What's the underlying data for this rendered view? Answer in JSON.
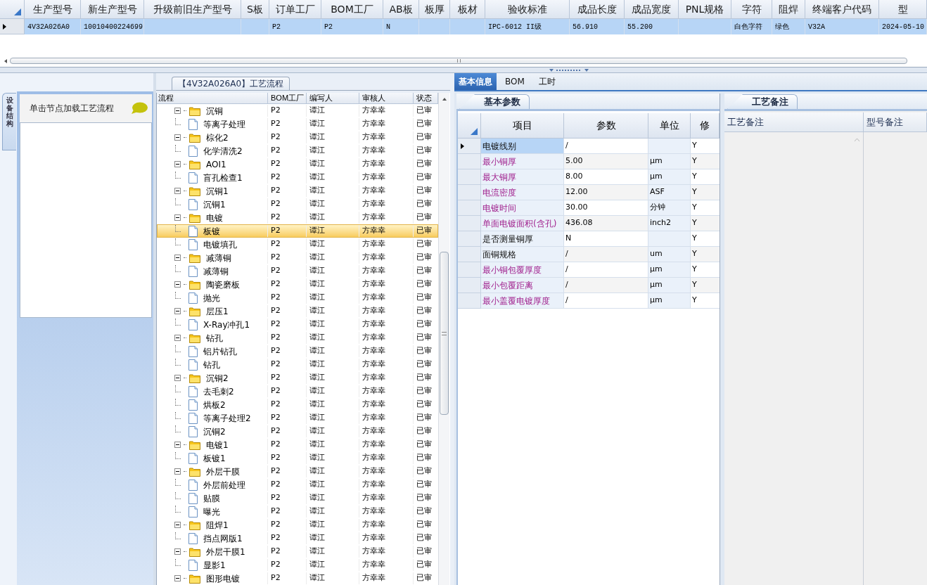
{
  "product_grid": {
    "columns": [
      "生产型号",
      "新生产型号",
      "升级前旧生产型号",
      "S板",
      "订单工厂",
      "BOM工厂",
      "AB板",
      "板厚",
      "板材",
      "验收标准",
      "成品长度",
      "成品宽度",
      "PNL规格",
      "字符",
      "阻焊",
      "终端客户代码",
      "型"
    ],
    "rows": [
      {
        "selected": true,
        "cells": [
          "4V32A026A0",
          "10010400224699",
          "",
          "",
          "P2",
          "P2",
          "N",
          "",
          "",
          "IPC-6012 II级",
          "56.910",
          "55.200",
          "",
          "白色字符",
          "绿色",
          "V32A",
          "2024-05-10"
        ]
      }
    ]
  },
  "side_tab": "设备结构",
  "hint": "单击节点加载工艺流程",
  "flow_title": "【4V32A026A0】工艺流程",
  "tree": {
    "columns": [
      "流程",
      "BOM工厂",
      "编写人",
      "审核人",
      "状态"
    ],
    "nodes": [
      {
        "label": "沉铜",
        "bom": "P2",
        "author": "谭江",
        "reviewer": "方幸幸",
        "status": "已审",
        "expanded": true,
        "selected": false,
        "children": [
          {
            "label": "等离子处理",
            "bom": "P2",
            "author": "谭江",
            "reviewer": "方幸幸",
            "status": "已审",
            "selected": false
          }
        ]
      },
      {
        "label": "棕化2",
        "bom": "P2",
        "author": "谭江",
        "reviewer": "方幸幸",
        "status": "已审",
        "expanded": true,
        "selected": false,
        "children": [
          {
            "label": "化学清洗2",
            "bom": "P2",
            "author": "谭江",
            "reviewer": "方幸幸",
            "status": "已审",
            "selected": false
          }
        ]
      },
      {
        "label": "AOI1",
        "bom": "P2",
        "author": "谭江",
        "reviewer": "方幸幸",
        "status": "已审",
        "expanded": true,
        "selected": false,
        "children": [
          {
            "label": "盲孔检查1",
            "bom": "P2",
            "author": "谭江",
            "reviewer": "方幸幸",
            "status": "已审",
            "selected": false
          }
        ]
      },
      {
        "label": "沉铜1",
        "bom": "P2",
        "author": "谭江",
        "reviewer": "方幸幸",
        "status": "已审",
        "expanded": true,
        "selected": false,
        "children": [
          {
            "label": "沉铜1",
            "bom": "P2",
            "author": "谭江",
            "reviewer": "方幸幸",
            "status": "已审",
            "selected": false
          }
        ]
      },
      {
        "label": "电镀",
        "bom": "P2",
        "author": "谭江",
        "reviewer": "方幸幸",
        "status": "已审",
        "expanded": true,
        "selected": false,
        "children": [
          {
            "label": "板镀",
            "bom": "P2",
            "author": "谭江",
            "reviewer": "方幸幸",
            "status": "已审",
            "selected": true
          },
          {
            "label": "电镀填孔",
            "bom": "P2",
            "author": "谭江",
            "reviewer": "方幸幸",
            "status": "已审",
            "selected": false
          }
        ]
      },
      {
        "label": "减薄铜",
        "bom": "P2",
        "author": "谭江",
        "reviewer": "方幸幸",
        "status": "已审",
        "expanded": true,
        "selected": false,
        "children": [
          {
            "label": "减薄铜",
            "bom": "P2",
            "author": "谭江",
            "reviewer": "方幸幸",
            "status": "已审",
            "selected": false
          }
        ]
      },
      {
        "label": "陶瓷磨板",
        "bom": "P2",
        "author": "谭江",
        "reviewer": "方幸幸",
        "status": "已审",
        "expanded": true,
        "selected": false,
        "children": [
          {
            "label": "抛光",
            "bom": "P2",
            "author": "谭江",
            "reviewer": "方幸幸",
            "status": "已审",
            "selected": false
          }
        ]
      },
      {
        "label": "层压1",
        "bom": "P2",
        "author": "谭江",
        "reviewer": "方幸幸",
        "status": "已审",
        "expanded": true,
        "selected": false,
        "children": [
          {
            "label": "X-Ray冲孔1",
            "bom": "P2",
            "author": "谭江",
            "reviewer": "方幸幸",
            "status": "已审",
            "selected": false
          }
        ]
      },
      {
        "label": "钻孔",
        "bom": "P2",
        "author": "谭江",
        "reviewer": "方幸幸",
        "status": "已审",
        "expanded": true,
        "selected": false,
        "children": [
          {
            "label": "铝片钻孔",
            "bom": "P2",
            "author": "谭江",
            "reviewer": "方幸幸",
            "status": "已审",
            "selected": false
          },
          {
            "label": "钻孔",
            "bom": "P2",
            "author": "谭江",
            "reviewer": "方幸幸",
            "status": "已审",
            "selected": false
          }
        ]
      },
      {
        "label": "沉铜2",
        "bom": "P2",
        "author": "谭江",
        "reviewer": "方幸幸",
        "status": "已审",
        "expanded": true,
        "selected": false,
        "children": [
          {
            "label": "去毛刺2",
            "bom": "P2",
            "author": "谭江",
            "reviewer": "方幸幸",
            "status": "已审",
            "selected": false
          },
          {
            "label": "烘板2",
            "bom": "P2",
            "author": "谭江",
            "reviewer": "方幸幸",
            "status": "已审",
            "selected": false
          },
          {
            "label": "等离子处理2",
            "bom": "P2",
            "author": "谭江",
            "reviewer": "方幸幸",
            "status": "已审",
            "selected": false
          },
          {
            "label": "沉铜2",
            "bom": "P2",
            "author": "谭江",
            "reviewer": "方幸幸",
            "status": "已审",
            "selected": false
          }
        ]
      },
      {
        "label": "电镀1",
        "bom": "P2",
        "author": "谭江",
        "reviewer": "方幸幸",
        "status": "已审",
        "expanded": true,
        "selected": false,
        "children": [
          {
            "label": "板镀1",
            "bom": "P2",
            "author": "谭江",
            "reviewer": "方幸幸",
            "status": "已审",
            "selected": false
          }
        ]
      },
      {
        "label": "外层干膜",
        "bom": "P2",
        "author": "谭江",
        "reviewer": "方幸幸",
        "status": "已审",
        "expanded": true,
        "selected": false,
        "children": [
          {
            "label": "外层前处理",
            "bom": "P2",
            "author": "谭江",
            "reviewer": "方幸幸",
            "status": "已审",
            "selected": false
          },
          {
            "label": "贴膜",
            "bom": "P2",
            "author": "谭江",
            "reviewer": "方幸幸",
            "status": "已审",
            "selected": false
          },
          {
            "label": "曝光",
            "bom": "P2",
            "author": "谭江",
            "reviewer": "方幸幸",
            "status": "已审",
            "selected": false
          }
        ]
      },
      {
        "label": "阻焊1",
        "bom": "P2",
        "author": "谭江",
        "reviewer": "方幸幸",
        "status": "已审",
        "expanded": true,
        "selected": false,
        "children": [
          {
            "label": "挡点网版1",
            "bom": "P2",
            "author": "谭江",
            "reviewer": "方幸幸",
            "status": "已审",
            "selected": false
          }
        ]
      },
      {
        "label": "外层干膜1",
        "bom": "P2",
        "author": "谭江",
        "reviewer": "方幸幸",
        "status": "已审",
        "expanded": true,
        "selected": false,
        "children": [
          {
            "label": "显影1",
            "bom": "P2",
            "author": "谭江",
            "reviewer": "方幸幸",
            "status": "已审",
            "selected": false
          }
        ]
      },
      {
        "label": "图形电镀",
        "bom": "P2",
        "author": "谭江",
        "reviewer": "方幸幸",
        "status": "已审",
        "expanded": true,
        "selected": false
      }
    ]
  },
  "detail_tabs": [
    {
      "label": "基本信息",
      "selected": true
    },
    {
      "label": "BOM",
      "selected": false
    },
    {
      "label": "工时",
      "selected": false
    }
  ],
  "params": {
    "tab": "基本参数",
    "columns": [
      "项目",
      "参数",
      "单位",
      "修"
    ],
    "rows": [
      {
        "item": "电镀线别",
        "value": "/",
        "unit": "",
        "modified": "Y",
        "emphasized": false,
        "selected": true
      },
      {
        "item": "最小铜厚",
        "value": "5.00",
        "unit": "μm",
        "modified": "Y",
        "emphasized": true,
        "selected": false
      },
      {
        "item": "最大铜厚",
        "value": "8.00",
        "unit": "μm",
        "modified": "Y",
        "emphasized": true,
        "selected": false
      },
      {
        "item": "电流密度",
        "value": "12.00",
        "unit": "ASF",
        "modified": "Y",
        "emphasized": true,
        "selected": false
      },
      {
        "item": "电镀时间",
        "value": "30.00",
        "unit": "分钟",
        "modified": "Y",
        "emphasized": true,
        "selected": false
      },
      {
        "item": "单面电镀面积(含孔)",
        "value": "436.08",
        "unit": "inch2",
        "modified": "Y",
        "emphasized": true,
        "selected": false
      },
      {
        "item": "是否测量铜厚",
        "value": "N",
        "unit": "",
        "modified": "Y",
        "emphasized": false,
        "selected": false
      },
      {
        "item": "面铜规格",
        "value": "/",
        "unit": "um",
        "modified": "Y",
        "emphasized": false,
        "selected": false
      },
      {
        "item": "最小铜包覆厚度",
        "value": "/",
        "unit": "μm",
        "modified": "Y",
        "emphasized": true,
        "selected": false
      },
      {
        "item": "最小包覆距离",
        "value": "/",
        "unit": "μm",
        "modified": "Y",
        "emphasized": true,
        "selected": false
      },
      {
        "item": "最小盖覆电镀厚度",
        "value": "/",
        "unit": "μm",
        "modified": "Y",
        "emphasized": true,
        "selected": false
      }
    ]
  },
  "notes": {
    "tab": "工艺备注",
    "columns": [
      "工艺备注",
      "型号备注"
    ]
  }
}
